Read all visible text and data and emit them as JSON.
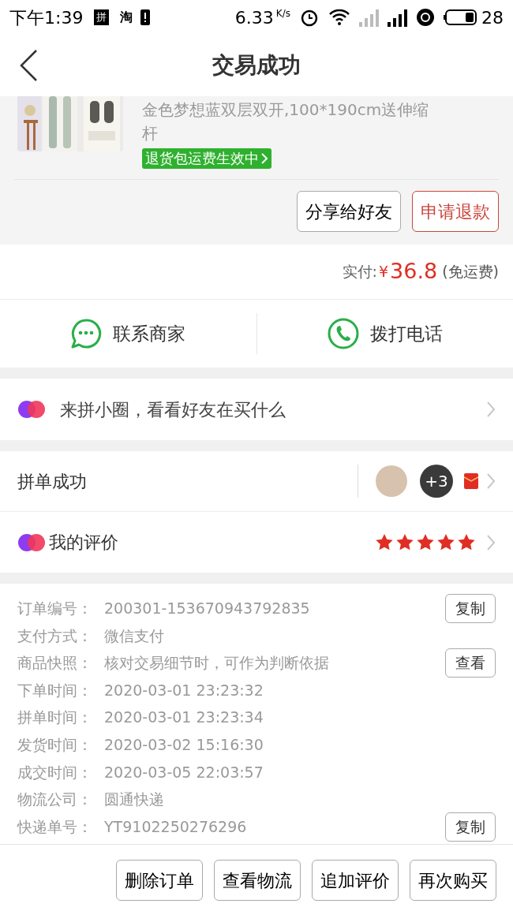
{
  "status_bar": {
    "time": "下午1:39",
    "notifications": [
      "拼",
      "淘"
    ],
    "speed": "6.33",
    "speed_unit": "K/s",
    "battery": "28"
  },
  "header": {
    "title": "交易成功"
  },
  "product": {
    "title": "金色梦想蓝双层双开,100*190cm送伸缩杆",
    "tag": "退货包运费生效中",
    "actions": [
      {
        "label": "分享给好友",
        "kind": "normal"
      },
      {
        "label": "申请退款",
        "kind": "danger"
      }
    ]
  },
  "payment": {
    "label": "实付:",
    "currency": "¥",
    "amount": "36.8",
    "note": "(免运费)"
  },
  "contact": [
    {
      "label": "联系商家",
      "kind": "chat"
    },
    {
      "label": "拨打电话",
      "kind": "phone"
    }
  ],
  "circle": {
    "label": "来拼小圈，看看好友在买什么"
  },
  "group": {
    "label": "拼单成功",
    "extra": "+3"
  },
  "review": {
    "label": "我的评价",
    "stars": 5
  },
  "details": [
    {
      "label": "订单编号：",
      "value": "200301-153670943792835",
      "action": "复制"
    },
    {
      "label": "支付方式：",
      "value": "微信支付"
    },
    {
      "label": "商品快照：",
      "value": "核对交易细节时，可作为判断依据",
      "action": "查看"
    },
    {
      "label": "下单时间：",
      "value": "2020-03-01 23:23:32"
    },
    {
      "label": "拼单时间：",
      "value": "2020-03-01 23:23:34"
    },
    {
      "label": "发货时间：",
      "value": "2020-03-02 15:16:30"
    },
    {
      "label": "成交时间：",
      "value": "2020-03-05 22:03:57"
    },
    {
      "label": "物流公司：",
      "value": "圆通快递"
    },
    {
      "label": "快递单号：",
      "value": "YT9102250276296",
      "action": "复制"
    }
  ],
  "bottom_actions": [
    "删除订单",
    "查看物流",
    "追加评价",
    "再次购买"
  ]
}
